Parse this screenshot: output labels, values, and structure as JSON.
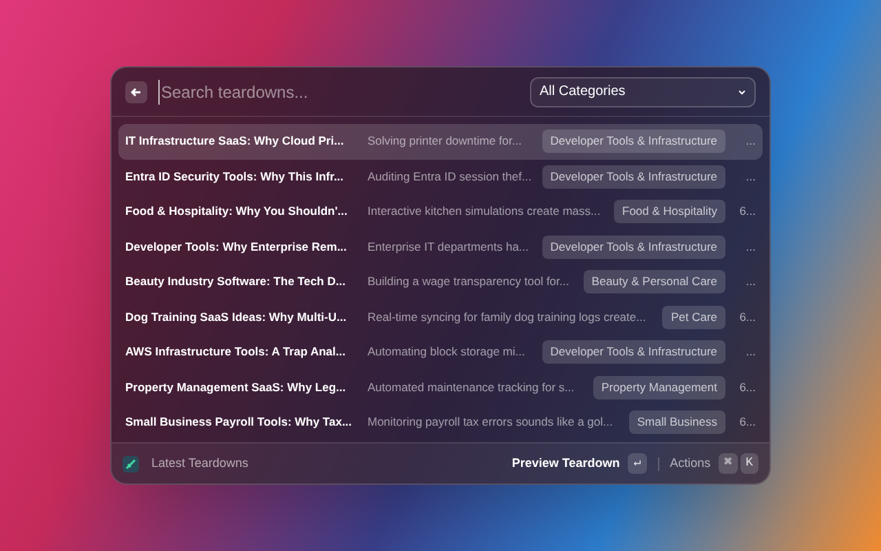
{
  "search": {
    "placeholder": "Search teardowns..."
  },
  "category_filter": {
    "value": "All Categories"
  },
  "rows": [
    {
      "title": "IT Infrastructure SaaS: Why Cloud Pri...",
      "subtitle": "Solving printer downtime for...",
      "tag": "Developer Tools & Infrastructure",
      "trailing": "...",
      "selected": true
    },
    {
      "title": "Entra ID Security Tools: Why This Infr...",
      "subtitle": "Auditing Entra ID session thef...",
      "tag": "Developer Tools & Infrastructure",
      "trailing": "...",
      "selected": false
    },
    {
      "title": "Food & Hospitality: Why You Shouldn'...",
      "subtitle": "Interactive kitchen simulations create mass...",
      "tag": "Food & Hospitality",
      "trailing": "6...",
      "selected": false
    },
    {
      "title": "Developer Tools: Why Enterprise Rem...",
      "subtitle": "Enterprise IT departments ha...",
      "tag": "Developer Tools & Infrastructure",
      "trailing": "...",
      "selected": false
    },
    {
      "title": "Beauty Industry Software: The Tech D...",
      "subtitle": "Building a wage transparency tool for...",
      "tag": "Beauty & Personal Care",
      "trailing": "...",
      "selected": false
    },
    {
      "title": "Dog Training SaaS Ideas: Why Multi-U...",
      "subtitle": "Real-time syncing for family dog training logs create...",
      "tag": "Pet Care",
      "trailing": "6...",
      "selected": false
    },
    {
      "title": "AWS Infrastructure Tools: A Trap Anal...",
      "subtitle": "Automating block storage mi...",
      "tag": "Developer Tools & Infrastructure",
      "trailing": "...",
      "selected": false
    },
    {
      "title": "Property Management SaaS: Why Leg...",
      "subtitle": "Automated maintenance tracking for s...",
      "tag": "Property Management",
      "trailing": "6...",
      "selected": false
    },
    {
      "title": "Small Business Payroll Tools: Why Tax...",
      "subtitle": "Monitoring payroll tax errors sounds like a gol...",
      "tag": "Small Business",
      "trailing": "6...",
      "selected": false
    }
  ],
  "footer": {
    "title": "Latest Teardowns",
    "primary_action": "Preview Teardown",
    "primary_key": "↵",
    "actions_label": "Actions",
    "action_keys": [
      "⌘",
      "K"
    ]
  }
}
